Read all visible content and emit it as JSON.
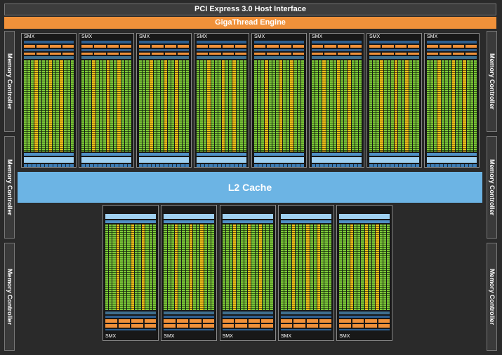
{
  "header": {
    "pcie_label": "PCI Express 3.0 Host Interface",
    "gigathread_label": "GigaThread Engine"
  },
  "memory_controller_label": "Memory Controller",
  "l2_label": "L2 Cache",
  "smx_label": "SMX",
  "smx_top_count": 8,
  "smx_bottom_count": 5,
  "colors": {
    "background": "#2a2a2a",
    "gigathread": "#f0913a",
    "l2_cache": "#6cb4e4",
    "core_green": "#7ec83a",
    "core_yellow": "#f2c21a"
  }
}
